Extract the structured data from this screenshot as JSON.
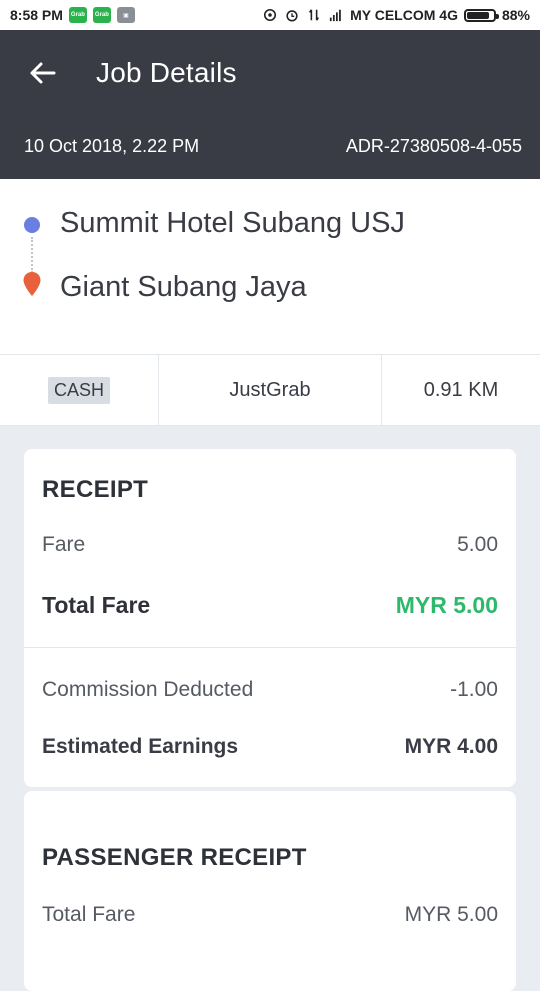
{
  "status_bar": {
    "time": "8:58 PM",
    "carrier": "MY CELCOM 4G",
    "battery": "88%",
    "battery_level": 0.88,
    "icons": [
      "grab-app-icon",
      "grab-app-icon",
      "app-icon",
      "hotspot-icon",
      "alarm-icon",
      "data-arrows-icon",
      "signal-icon",
      "battery-icon"
    ]
  },
  "header": {
    "title": "Job Details",
    "date": "10 Oct 2018, 2.22 PM",
    "job_id": "ADR-27380508-4-055",
    "background": "#3a3c45"
  },
  "route": {
    "pickup": "Summit Hotel Subang USJ",
    "dropoff": "Giant Subang Jaya",
    "pickup_color": "#6b7ee2",
    "dropoff_color": "#e8613c"
  },
  "trip_info": {
    "payment": "CASH",
    "service": "JustGrab",
    "distance": "0.91 KM"
  },
  "receipt": {
    "title": "RECEIPT",
    "fare_label": "Fare",
    "fare_value": "5.00",
    "total_label": "Total Fare",
    "total_value": "MYR 5.00",
    "commission_label": "Commission Deducted",
    "commission_value": "-1.00",
    "earnings_label": "Estimated Earnings",
    "earnings_value": "MYR 4.00",
    "accent": "#2eb86a"
  },
  "passenger_receipt": {
    "title": "PASSENGER RECEIPT",
    "total_label": "Total Fare",
    "total_value": "MYR 5.00"
  }
}
